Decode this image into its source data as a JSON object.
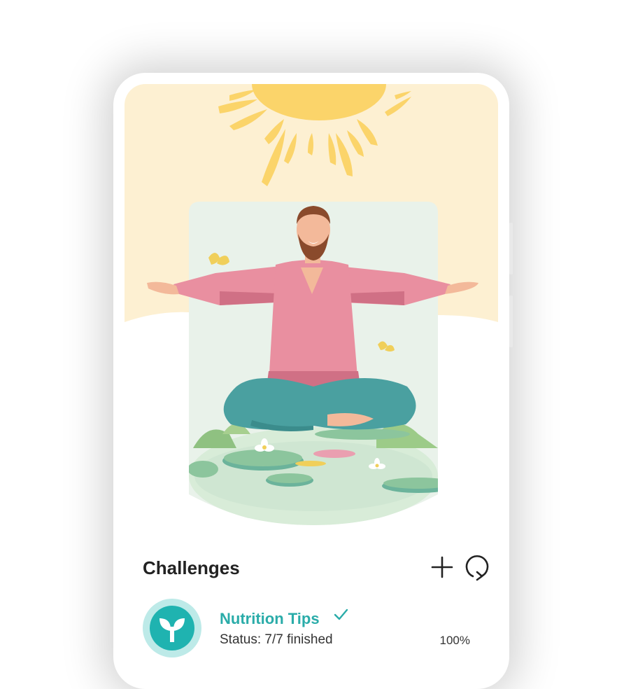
{
  "challenges": {
    "title": "Challenges",
    "add_icon": "plus-icon",
    "refresh_icon": "refresh-icon",
    "items": [
      {
        "name": "Nutrition Tips",
        "status": "Status: 7/7 finished",
        "percent": "100%",
        "progress": 1.0,
        "completed": true,
        "icon": "sprout-icon"
      }
    ]
  },
  "colors": {
    "accent": "#2aaca9",
    "hero_background": "#fdf0d2",
    "sun": "#fbd46a"
  }
}
